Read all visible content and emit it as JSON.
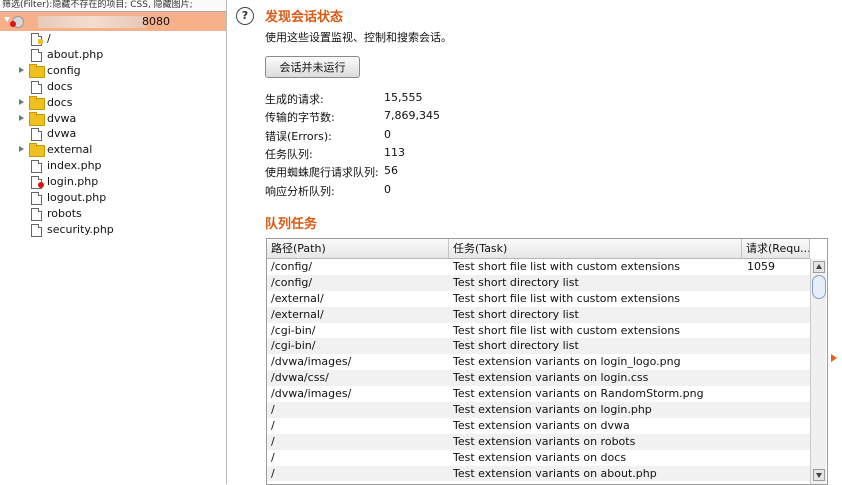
{
  "filter_bar": {
    "text": "筛选(Filter):隐藏不存在的项目; CSS, 隐藏图片;"
  },
  "site_tree": {
    "root_label": "8080",
    "items": [
      {
        "label": "/",
        "kind": "file-folder",
        "expandable": false
      },
      {
        "label": "about.php",
        "kind": "file",
        "expandable": false
      },
      {
        "label": "config",
        "kind": "folder",
        "expandable": true
      },
      {
        "label": "docs",
        "kind": "file",
        "expandable": false
      },
      {
        "label": "docs",
        "kind": "folder",
        "expandable": true
      },
      {
        "label": "dvwa",
        "kind": "folder",
        "expandable": true
      },
      {
        "label": "dvwa",
        "kind": "file",
        "expandable": false
      },
      {
        "label": "external",
        "kind": "folder",
        "expandable": true
      },
      {
        "label": "index.php",
        "kind": "file",
        "expandable": false
      },
      {
        "label": "login.php",
        "kind": "file-alert",
        "expandable": false
      },
      {
        "label": "logout.php",
        "kind": "file",
        "expandable": false
      },
      {
        "label": "robots",
        "kind": "file",
        "expandable": false
      },
      {
        "label": "security.php",
        "kind": "file",
        "expandable": false
      }
    ]
  },
  "session": {
    "help_glyph": "?",
    "title": "发现会话状态",
    "description": "使用这些设置监视、控制和搜索会话。",
    "button_label": "会话并未运行",
    "stats": [
      {
        "label": "生成的请求:",
        "value": "15,555"
      },
      {
        "label": "传输的字节数:",
        "value": "7,869,345"
      },
      {
        "label": "错误(Errors):",
        "value": "0"
      },
      {
        "label": "任务队列:",
        "value": "113"
      },
      {
        "label": "使用蜘蛛爬行请求队列:",
        "value": "56"
      },
      {
        "label": "响应分析队列:",
        "value": "0"
      }
    ]
  },
  "queue": {
    "title": "队列任务",
    "columns": [
      "路径(Path)",
      "任务(Task)",
      "请求(Requ..."
    ],
    "rows": [
      {
        "path": "/config/",
        "task": "Test short file list with custom extensions",
        "requests": "1059"
      },
      {
        "path": "/config/",
        "task": "Test short directory list",
        "requests": ""
      },
      {
        "path": "/external/",
        "task": "Test short file list with custom extensions",
        "requests": ""
      },
      {
        "path": "/external/",
        "task": "Test short directory list",
        "requests": ""
      },
      {
        "path": "/cgi-bin/",
        "task": "Test short file list with custom extensions",
        "requests": ""
      },
      {
        "path": "/cgi-bin/",
        "task": "Test short directory list",
        "requests": ""
      },
      {
        "path": "/dvwa/images/",
        "task": "Test extension variants on login_logo.png",
        "requests": ""
      },
      {
        "path": "/dvwa/css/",
        "task": "Test extension variants on login.css",
        "requests": ""
      },
      {
        "path": "/dvwa/images/",
        "task": "Test extension variants on RandomStorm.png",
        "requests": ""
      },
      {
        "path": "/",
        "task": "Test extension variants on login.php",
        "requests": ""
      },
      {
        "path": "/",
        "task": "Test extension variants on dvwa",
        "requests": ""
      },
      {
        "path": "/",
        "task": "Test extension variants on robots",
        "requests": ""
      },
      {
        "path": "/",
        "task": "Test extension variants on docs",
        "requests": ""
      },
      {
        "path": "/",
        "task": "Test extension variants on about.php",
        "requests": ""
      }
    ]
  },
  "colors": {
    "accent": "#d85a14",
    "selection": "#f6b08a",
    "alert": "#d11111",
    "folder": "#f0c020"
  }
}
